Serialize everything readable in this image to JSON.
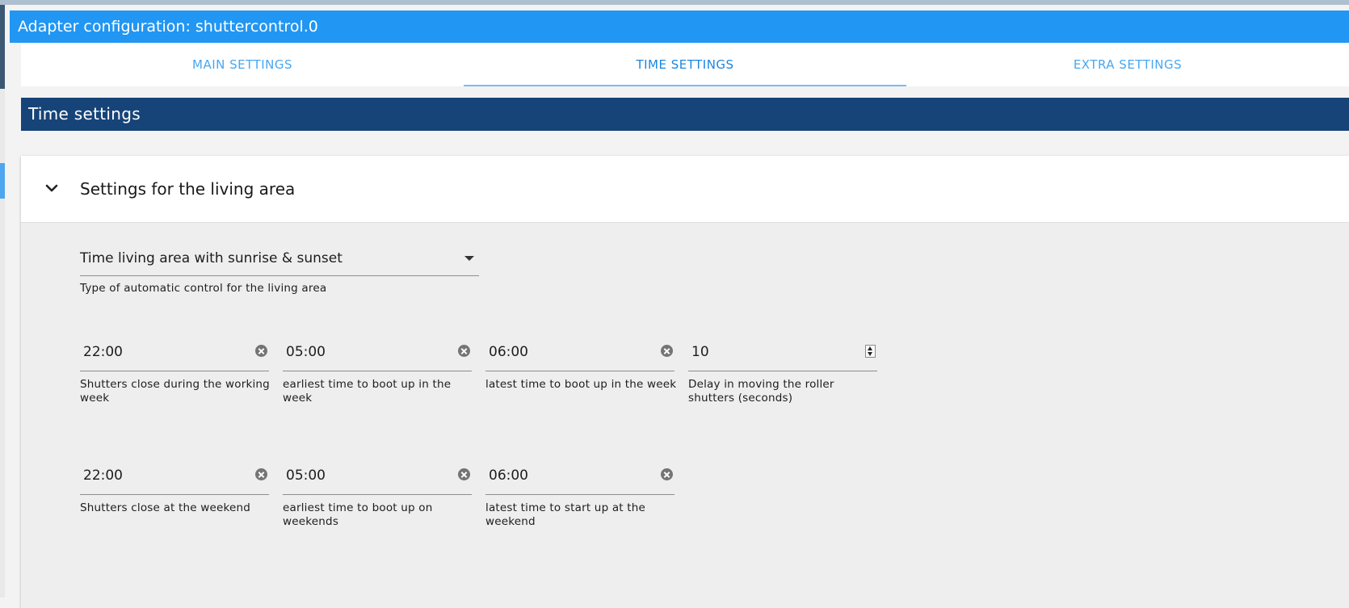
{
  "window": {
    "title": "Adapter configuration: shuttercontrol.0"
  },
  "tabs": [
    {
      "label": "MAIN SETTINGS",
      "active": false
    },
    {
      "label": "TIME SETTINGS",
      "active": true
    },
    {
      "label": "EXTRA SETTINGS",
      "active": false
    }
  ],
  "section": {
    "title": "Time settings"
  },
  "panel": {
    "title": "Settings for the living area",
    "expanded": true,
    "control_type": {
      "value": "Time living area with sunrise & sunset",
      "helper": "Type of automatic control for the living area"
    },
    "row1": [
      {
        "value": "22:00",
        "helper": "Shutters close during the working week",
        "icon": "clear-icon"
      },
      {
        "value": "05:00",
        "helper": "earliest time to boot up in the week",
        "icon": "clear-icon"
      },
      {
        "value": "06:00",
        "helper": "latest time to boot up in the week",
        "icon": "clear-icon"
      },
      {
        "value": "10",
        "helper": "Delay in moving the roller shutters (seconds)",
        "icon": "spinner-icon"
      }
    ],
    "row2": [
      {
        "value": "22:00",
        "helper": "Shutters close at the weekend",
        "icon": "clear-icon"
      },
      {
        "value": "05:00",
        "helper": "earliest time to boot up on weekends",
        "icon": "clear-icon"
      },
      {
        "value": "06:00",
        "helper": "latest time to start up at the weekend",
        "icon": "clear-icon"
      }
    ]
  },
  "colors": {
    "title_bar": "#2196f3",
    "section_bar": "#174478",
    "tab_text": "#47a7f2",
    "panel_bg": "#eeeeee"
  }
}
